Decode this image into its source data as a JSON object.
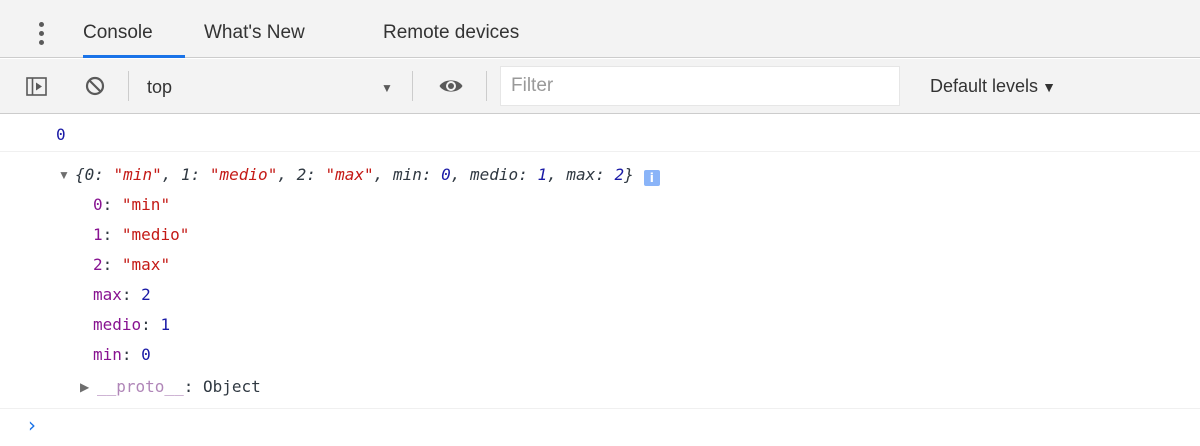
{
  "tabs": [
    {
      "label": "Console",
      "active": true
    },
    {
      "label": "What's New",
      "active": false
    },
    {
      "label": "Remote devices",
      "active": false
    }
  ],
  "toolbar": {
    "context": "top",
    "filter_placeholder": "Filter",
    "filter_value": "",
    "levels_label": "Default levels",
    "levels_arrow": "▼",
    "context_arrow": "▼"
  },
  "console": {
    "first_output": "0",
    "object": {
      "summary": {
        "open": "{",
        "k0": "0",
        "v0": "\"min\"",
        "k1": "1",
        "v1": "\"medio\"",
        "k2": "2",
        "v2": "\"max\"",
        "kmin": "min",
        "vmin": "0",
        "kmedio": "medio",
        "vmedio": "1",
        "kmax": "max",
        "vmax": "2",
        "close": "}",
        "colon": ": ",
        "comma": ", "
      },
      "info_badge": "i",
      "properties": [
        {
          "key": "0",
          "value": "\"min\"",
          "type": "string"
        },
        {
          "key": "1",
          "value": "\"medio\"",
          "type": "string"
        },
        {
          "key": "2",
          "value": "\"max\"",
          "type": "string"
        },
        {
          "key": "max",
          "value": "2",
          "type": "number"
        },
        {
          "key": "medio",
          "value": "1",
          "type": "number"
        },
        {
          "key": "min",
          "value": "0",
          "type": "number"
        }
      ],
      "proto": {
        "key": "__proto__",
        "value": "Object"
      }
    },
    "prompt": "›"
  },
  "colors": {
    "accent": "#1a73e8",
    "string": "#c41a16",
    "number": "#1a1aa6",
    "key": "#881391"
  }
}
